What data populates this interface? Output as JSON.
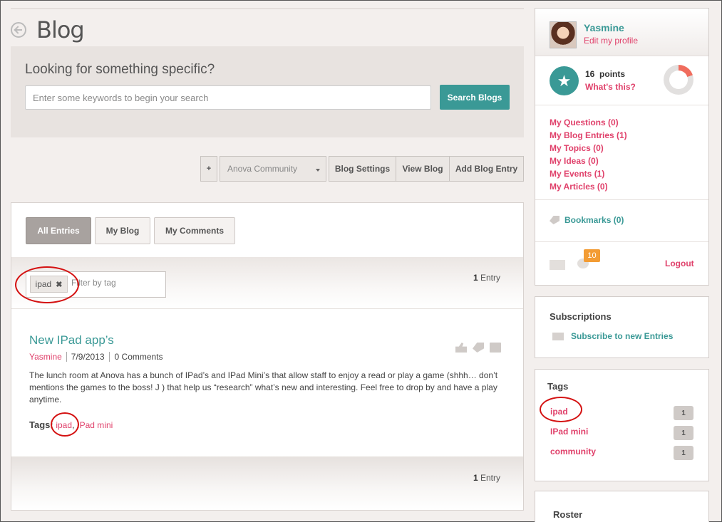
{
  "header": {
    "title": "Blog"
  },
  "search": {
    "heading": "Looking for something specific?",
    "placeholder": "Enter some keywords to begin your search",
    "button": "Search Blogs"
  },
  "toolbar": {
    "plus": "+",
    "community": "Anova Community",
    "blog_settings": "Blog Settings",
    "view_blog": "View Blog",
    "add_entry": "Add Blog Entry"
  },
  "tabs": [
    "All Entries",
    "My Blog",
    "My Comments"
  ],
  "filter": {
    "active_tag": "ipad",
    "placeholder": "Filter by tag",
    "entry_count_num": "1",
    "entry_count_label": " Entry"
  },
  "post": {
    "title": "New IPad app’s",
    "author": "Yasmine",
    "date": "7/9/2013",
    "comments": "0 Comments",
    "body": "The lunch room at Anova has a bunch of IPad’s and IPad Mini’s that allow staff to enjoy a read or play a game (shhh… don’t mentions the games to the boss! J ) that help us “research” what’s new and interesting. Feel free to drop by and have a play anytime.",
    "tags_label": "Tags:",
    "tags": [
      "ipad",
      "IPad mini"
    ]
  },
  "profile": {
    "name": "Yasmine",
    "edit": "Edit my profile",
    "points_value": "16",
    "points_label": "points",
    "whats_this": "What's this?",
    "points_progress": 0.2,
    "links": [
      "My Questions (0)",
      "My Blog Entries (1)",
      "My Topics (0)",
      "My Ideas (0)",
      "My Events (1)",
      "My Articles (0)"
    ],
    "bookmarks": "Bookmarks (0)",
    "notifications": "10",
    "logout": "Logout"
  },
  "subscriptions": {
    "title": "Subscriptions",
    "link": "Subscribe to new Entries"
  },
  "tags_panel": {
    "title": "Tags",
    "items": [
      {
        "label": "ipad",
        "count": "1"
      },
      {
        "label": "IPad mini",
        "count": "1"
      },
      {
        "label": "community",
        "count": "1"
      }
    ]
  },
  "roster": {
    "title": "Roster"
  },
  "colors": {
    "teal": "#3a9996",
    "pink": "#e0416b",
    "orange": "#f39c34",
    "annotation_red": "#d41111"
  }
}
